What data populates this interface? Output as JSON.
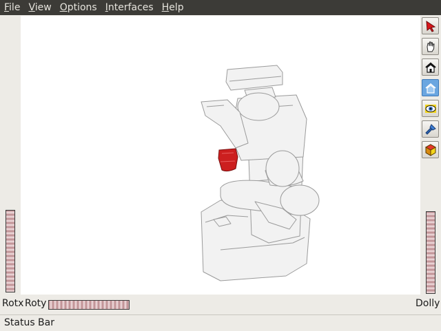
{
  "menu": [
    {
      "label": "File",
      "mnemonic": "F",
      "rest": "ile"
    },
    {
      "label": "View",
      "mnemonic": "V",
      "rest": "iew"
    },
    {
      "label": "Options",
      "mnemonic": "O",
      "rest": "ptions"
    },
    {
      "label": "Interfaces",
      "mnemonic": "I",
      "rest": "nterfaces"
    },
    {
      "label": "Help",
      "mnemonic": "H",
      "rest": "elp"
    }
  ],
  "toolbar": [
    {
      "icon": "pick-arrow-icon",
      "active": false
    },
    {
      "icon": "hand-icon",
      "active": false
    },
    {
      "icon": "home-icon",
      "active": false
    },
    {
      "icon": "set-home-icon",
      "active": true
    },
    {
      "icon": "eye-icon",
      "active": false
    },
    {
      "icon": "seek-flashlight-icon",
      "active": false
    },
    {
      "icon": "cube-projection-icon",
      "active": false
    }
  ],
  "wheels": {
    "rotx_label": "Rotx",
    "roty_label": "Roty",
    "dolly_label": "Dolly"
  },
  "status": {
    "text": "Status Bar"
  },
  "scene": {
    "model": "robot",
    "highlight_object": "red-cup",
    "highlight_color": "#cc1f1f",
    "model_color": "#f2f2f2"
  }
}
